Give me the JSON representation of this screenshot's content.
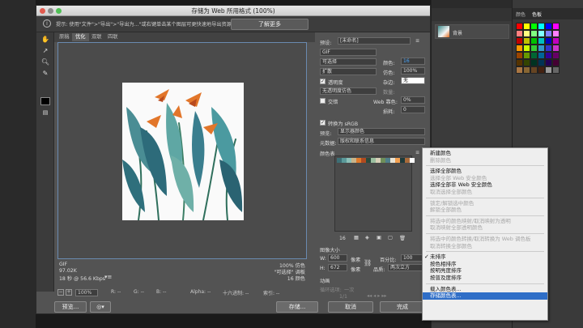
{
  "window": {
    "title": "存储为 Web 所用格式 (100%)"
  },
  "infobar": {
    "message": "提示: 使用\"文件\">\"导出\">\"导出为...\"或右键单击某个图层可更快速地导出资源",
    "learn_more": "了解更多"
  },
  "tabs": [
    "原稿",
    "优化",
    "双联",
    "四联"
  ],
  "preview_info": {
    "format": "GIF",
    "size": "97.02K",
    "time": "18 秒 @ 56.6 Kbps",
    "quality": "100% 仿色",
    "palette": "\"可选择\" 调板",
    "colors": "16 颜色"
  },
  "statusbar": {
    "zoom": "100%",
    "r": "R: --",
    "g": "G: --",
    "b": "B: --",
    "alpha": "Alpha: --",
    "hex": "十六进制: --",
    "index": "索引: --"
  },
  "buttons": {
    "preview": "预览...",
    "save": "存储...",
    "cancel": "取消",
    "done": "完成"
  },
  "settings": {
    "preset_label": "预设:",
    "preset_value": "[未命名]",
    "format": "GIF",
    "reduction": "可选择",
    "dither_algo": "扩散",
    "colors_label": "颜色:",
    "colors_value": "16",
    "dither_label": "仿色:",
    "dither_value": "100%",
    "transparency": "透明度",
    "matte_label": "杂边:",
    "matte_value": "无",
    "trans_dither": "无透明度仿色",
    "amount_label": "数量:",
    "interlaced": "交错",
    "web_snap_label": "Web 靠色:",
    "web_snap_value": "0%",
    "lossy_label": "损耗:",
    "lossy_value": "0",
    "convert_srgb": "转换为 sRGB",
    "preview_label": "预览:",
    "preview_value": "显示器颜色",
    "metadata_label": "元数据:",
    "metadata_value": "版权和联系信息",
    "color_table": "颜色表",
    "color_count": "16",
    "image_size": "图像大小",
    "w_label": "W:",
    "w_value": "600",
    "h_label": "H:",
    "h_value": "672",
    "unit": "像素",
    "percent_label": "百分比:",
    "percent_value": "100",
    "quality_label": "品质:",
    "quality_value": "两次立方",
    "animation": "动画",
    "loop_label": "循环选项:",
    "loop_value": "一次",
    "frame": "1/1"
  },
  "swatch_colors": [
    "#3d6f76",
    "#5b9a9a",
    "#8cc0b8",
    "#c9b48a",
    "#e07a2a",
    "#b04a20",
    "#2b4a3c",
    "#9bbfa0",
    "#d8d0b8",
    "#6f8f5a",
    "#4f7f8a",
    "#e9e4d6",
    "#f3a050",
    "#1f3a3a",
    "#a86a3a",
    "#ffffff"
  ],
  "context_menu": [
    {
      "label": "新建颜色",
      "enabled": true
    },
    {
      "label": "删除颜色",
      "enabled": false
    },
    {
      "sep": true
    },
    {
      "label": "选择全部颜色",
      "enabled": true
    },
    {
      "label": "选择全部 Web 安全颜色",
      "enabled": false
    },
    {
      "label": "选择全部非 Web 安全颜色",
      "enabled": true
    },
    {
      "label": "取消选择全部颜色",
      "enabled": false
    },
    {
      "sep": true
    },
    {
      "label": "锁定/解锁选中颜色",
      "enabled": false
    },
    {
      "label": "解锁全部颜色",
      "enabled": false
    },
    {
      "sep": true
    },
    {
      "label": "将选中的颜色映射/取消映射为透明",
      "enabled": false
    },
    {
      "label": "取消映射全部透明颜色",
      "enabled": false
    },
    {
      "sep": true
    },
    {
      "label": "将选中的颜色转换/取消转换为 Web 调色板",
      "enabled": false
    },
    {
      "label": "取消转换全部颜色",
      "enabled": false
    },
    {
      "sep": true
    },
    {
      "label": "未排序",
      "enabled": true,
      "checked": true
    },
    {
      "label": "按色相排序",
      "enabled": true
    },
    {
      "label": "按明亮度排序",
      "enabled": true
    },
    {
      "label": "按普及度排序",
      "enabled": true
    },
    {
      "sep": true
    },
    {
      "label": "载入颜色表...",
      "enabled": true
    },
    {
      "label": "存储颜色表...",
      "enabled": true,
      "highlighted": true
    }
  ],
  "bg": {
    "layer_name": "背景",
    "panel_tab": "色板",
    "panel_tab2": "颜色"
  }
}
